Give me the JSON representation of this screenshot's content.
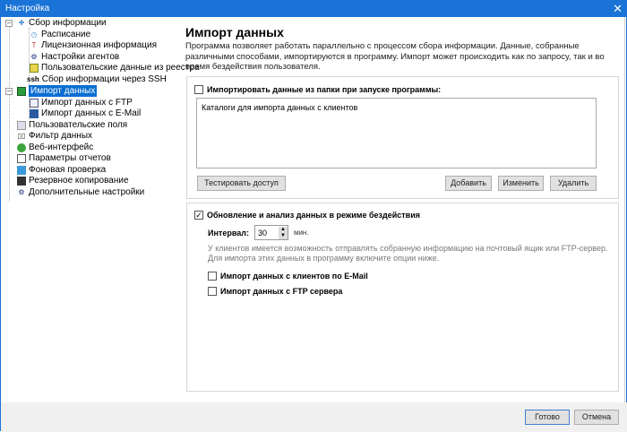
{
  "window": {
    "title": "Настройка",
    "close": "✕"
  },
  "tree": [
    {
      "label": "Сбор информации",
      "icon": "network-icon"
    },
    {
      "label": "Расписание",
      "icon": "clock-icon"
    },
    {
      "label": "Лицензионная информация",
      "icon": "license-icon"
    },
    {
      "label": "Настройки агентов",
      "icon": "gears-icon"
    },
    {
      "label": "Пользовательские данные из реестра",
      "icon": "grid-icon"
    },
    {
      "label": "Сбор информации через SSH",
      "icon": "ssh-icon",
      "icon_text": "ssh"
    },
    {
      "label": "Импорт данных",
      "icon": "import-icon"
    },
    {
      "label": "Импорт данных с FTP",
      "icon": "ftp-icon"
    },
    {
      "label": "Импорт данных с E-Mail",
      "icon": "email-icon"
    },
    {
      "label": "Пользовательские поля",
      "icon": "fields-icon"
    },
    {
      "label": "Фильтр данных",
      "icon": "filter-icon"
    },
    {
      "label": "Веб-интерфейс",
      "icon": "globe-icon"
    },
    {
      "label": "Параметры отчетов",
      "icon": "report-icon"
    },
    {
      "label": "Фоновая проверка",
      "icon": "monitor-icon"
    },
    {
      "label": "Резервное копирование",
      "icon": "floppy-icon"
    },
    {
      "label": "Дополнительные настройки",
      "icon": "gears-icon"
    }
  ],
  "main": {
    "title": "Импорт данных",
    "description": "Программа позволяет работать параллельно с процессом сбора информации. Данные, собранные различными способами, импортируются в программу. Импорт может происходить как по запросу, так и во время бездействия пользователя.",
    "folder_import": {
      "label": "Импортировать данные из папки при запуске программы:",
      "checked": false,
      "list_header": "Каталоги для импорта данных с клиентов",
      "test_button": "Тестировать доступ",
      "add_button": "Добавить",
      "edit_button": "Изменить",
      "delete_button": "Удалить"
    },
    "idle": {
      "label": "Обновление и анализ данных в режиме бездействия",
      "checked": true,
      "interval_label": "Интервал:",
      "interval_value": "30",
      "interval_unit": "мин.",
      "note": "У клиентов имеется возможность отправлять собранную информацию на почтовый ящик или FTP-сервер. Для импорта этих данных в программу включите опции ниже.",
      "email_label": "Импорт данных с клиентов по E-Mail",
      "email_checked": false,
      "ftp_label": "Импорт данных с FTP сервера",
      "ftp_checked": false
    }
  },
  "footer": {
    "ok": "Готово",
    "cancel": "Отмена"
  }
}
